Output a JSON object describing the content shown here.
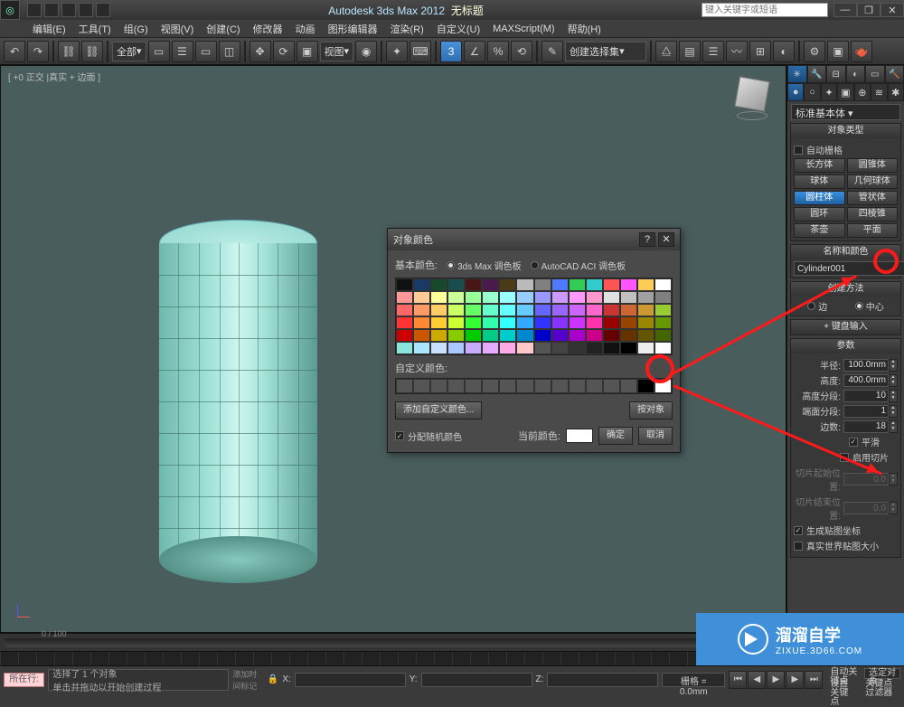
{
  "app": {
    "title": "Autodesk 3ds Max 2012",
    "doc": "无标题",
    "search_placeholder": "键入关键字或短语"
  },
  "menu": [
    "编辑(E)",
    "工具(T)",
    "组(G)",
    "视图(V)",
    "创建(C)",
    "修改器",
    "动画",
    "图形编辑器",
    "渲染(R)",
    "自定义(U)",
    "MAXScript(M)",
    "帮助(H)"
  ],
  "toolbar": {
    "all_label": "全部",
    "view_label": "视图",
    "selset_label": "创建选择集"
  },
  "viewport": {
    "label": "[ +0 正交 |真实 + 边面 ]"
  },
  "cmdpanel": {
    "primitive_set": "标准基本体",
    "obj_type_title": "对象类型",
    "autogrid": "自动栅格",
    "objects": [
      "长方体",
      "圆锥体",
      "球体",
      "几何球体",
      "圆柱体",
      "管状体",
      "圆环",
      "四棱锥",
      "茶壶",
      "平面"
    ],
    "selected_obj": "圆柱体",
    "name_title": "名称和颜色",
    "obj_name": "Cylinder001",
    "create_method_title": "创建方法",
    "edge": "边",
    "center": "中心",
    "kb_title": "键盘输入",
    "params_title": "参数",
    "radius_lbl": "半径:",
    "radius": "100.0mm",
    "height_lbl": "高度:",
    "height": "400.0mm",
    "hseg_lbl": "高度分段:",
    "hseg": "10",
    "cseg_lbl": "端面分段:",
    "cseg": "1",
    "sides_lbl": "边数:",
    "sides": "18",
    "smooth": "平滑",
    "slice_on": "启用切片",
    "slice_from_lbl": "切片起始位置:",
    "slice_from": "0.0",
    "slice_to_lbl": "切片结束位置:",
    "slice_to": "0.0",
    "gen_uv": "生成贴图坐标",
    "real_uv": "真实世界贴图大小"
  },
  "dialog": {
    "title": "对象颜色",
    "basic": "基本颜色:",
    "pal1": "3ds Max 调色板",
    "pal2": "AutoCAD ACI 调色板",
    "custom": "自定义颜色:",
    "add": "添加自定义颜色...",
    "byobj": "按对象",
    "rand": "分配随机颜色",
    "current": "当前颜色:",
    "ok": "确定",
    "cancel": "取消",
    "palette_colors": [
      "#111",
      "#1a3a66",
      "#174a2b",
      "#1a4d4d",
      "#4a1717",
      "#4a1a4a",
      "#4a3a17",
      "#bababa",
      "#808080",
      "#4d7aff",
      "#33cc55",
      "#33cccc",
      "#ff5555",
      "#ff55ff",
      "#ffcc55",
      "#ffffff",
      "#ff9999",
      "#ffcc99",
      "#ffff99",
      "#ccff99",
      "#99ff99",
      "#99ffcc",
      "#99ffff",
      "#99ccff",
      "#9999ff",
      "#cc99ff",
      "#ff99ff",
      "#ff99cc",
      "#e0e0e0",
      "#c0c0c0",
      "#a0a0a0",
      "#808080",
      "#ff6666",
      "#ff9966",
      "#ffcc66",
      "#ccff66",
      "#66ff66",
      "#66ffcc",
      "#66ffff",
      "#66ccff",
      "#6666ff",
      "#9966ff",
      "#cc66ff",
      "#ff66cc",
      "#cc3333",
      "#cc6633",
      "#cc9933",
      "#99cc33",
      "#ff3333",
      "#ff8833",
      "#ffcc33",
      "#ccff33",
      "#33ff33",
      "#33ffaa",
      "#33ffff",
      "#33aaff",
      "#3333ff",
      "#8833ff",
      "#cc33ff",
      "#ff33aa",
      "#990000",
      "#994400",
      "#998800",
      "#669900",
      "#cc0000",
      "#cc5500",
      "#ccaa00",
      "#88cc00",
      "#00cc00",
      "#00cc88",
      "#00cccc",
      "#0088cc",
      "#0000cc",
      "#5500cc",
      "#aa00cc",
      "#cc0088",
      "#660000",
      "#663300",
      "#665500",
      "#446600",
      "#88e6dd",
      "#a8e6ff",
      "#c8e0ff",
      "#aac8ff",
      "#c8aaff",
      "#e6aaff",
      "#ffaae6",
      "#ffc8c8",
      "#555",
      "#444",
      "#333",
      "#222",
      "#111",
      "#000",
      "#eee",
      "#fff"
    ]
  },
  "status": {
    "sel": "选择了 1 个对象",
    "hint": "单击并拖动以开始创建过程",
    "timehint": "添加时间标记",
    "x": "X:",
    "y": "Y:",
    "z": "Z:",
    "grid_lbl": "栅格 = 0.0mm",
    "autokey": "自动关键点",
    "selkey": "选定对象",
    "setkey": "设置关键点",
    "kfilter": "关键点过滤器",
    "track_range": "0 / 100",
    "now": "所在行:"
  },
  "watermark": {
    "l1": "溜溜自学",
    "l2": "ZIXUE.3D66.COM"
  }
}
